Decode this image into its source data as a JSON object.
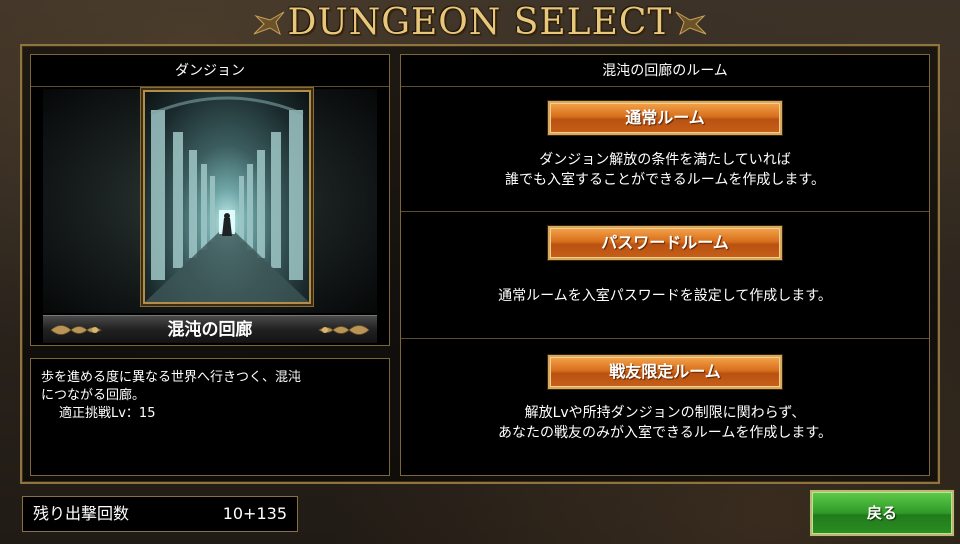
{
  "title": "DUNGEON SELECT",
  "left_panel": {
    "header": "ダンジョン",
    "dungeon_name": "混沌の回廊",
    "description_line1": "歩を進める度に異なる世界へ行きつく、混沌",
    "description_line2": "につながる回廊。",
    "recommended_level": "適正挑戦Lv：15"
  },
  "right_panel": {
    "header": "混沌の回廊のルーム",
    "rooms": [
      {
        "button_label": "通常ルーム",
        "desc_line1": "ダンジョン解放の条件を満たしていれば",
        "desc_line2": "誰でも入室することができるルームを作成します。"
      },
      {
        "button_label": "パスワードルーム",
        "desc_line1": "通常ルームを入室パスワードを設定して作成します。",
        "desc_line2": ""
      },
      {
        "button_label": "戦友限定ルーム",
        "desc_line1": "解放Lvや所持ダンジョンの制限に関わらず、",
        "desc_line2": "あなたの戦友のみが入室できるルームを作成します。"
      }
    ]
  },
  "footer": {
    "sortie_label": "残り出撃回数",
    "sortie_value": "10+135",
    "back_label": "戻る"
  },
  "colors": {
    "gold": "#e8c77a",
    "frame": "#8f7440",
    "room_button": "#d86f1c",
    "back_button": "#2f9a27"
  }
}
